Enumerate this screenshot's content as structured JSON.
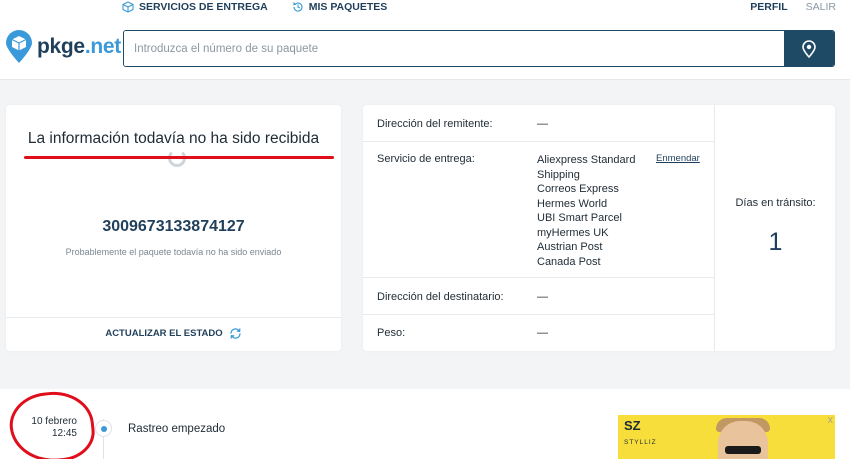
{
  "header": {
    "nav": [
      {
        "label": "SERVICIOS DE ENTREGA",
        "icon": "box-icon"
      },
      {
        "label": "MIS PAQUETES",
        "icon": "history-icon"
      }
    ],
    "auth": {
      "profile": "PERFIL",
      "logout": "SALIR"
    },
    "logo": {
      "name": "pkge",
      "suffix": ".net"
    },
    "search": {
      "placeholder": "Introduzca el número de su paquete",
      "button_icon": "location-pin-icon"
    }
  },
  "package": {
    "status_title": "La información todavía no ha sido recibida",
    "tracking_number": "3009673133874127",
    "note": "Probablemente el paquete todavía no ha sido enviado",
    "update_label": "ACTUALIZAR EL ESTADO"
  },
  "details": {
    "sender": {
      "label": "Dirección del remitente:",
      "value": "—"
    },
    "service": {
      "label": "Servicio de entrega:",
      "values": [
        "Aliexpress Standard",
        "Shipping",
        "Correos Express",
        "Hermes World",
        "UBI Smart Parcel",
        "myHermes UK",
        "Austrian Post",
        "Canada Post"
      ],
      "edit_label": "Enmendar"
    },
    "recipient": {
      "label": "Dirección del destinatario:",
      "value": "—"
    },
    "weight": {
      "label": "Peso:",
      "value": "—"
    }
  },
  "transit": {
    "label": "Días en tránsito:",
    "value": "1"
  },
  "timeline": [
    {
      "date": "10 febrero",
      "time": "12:45",
      "event": "Rastreo empezado"
    }
  ],
  "ad": {
    "brand": "SZ",
    "brand_sub": "STYLLIZ",
    "close": "X"
  },
  "colors": {
    "primary": "#1f4a66",
    "accent": "#3a9ad9",
    "annotation": "#e00d1a"
  }
}
